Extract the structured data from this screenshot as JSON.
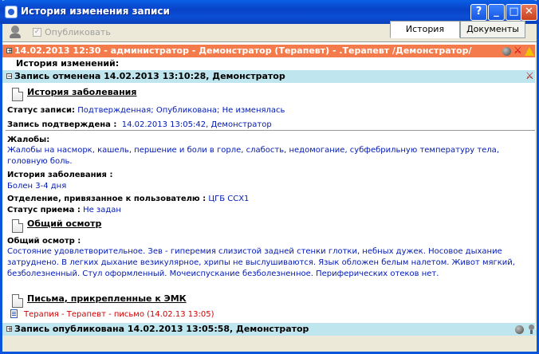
{
  "window": {
    "title": "История изменения записи"
  },
  "toolbar": {
    "publish_label": "Опубликовать",
    "publish_checked": true,
    "tabs": [
      "История",
      "Документы"
    ],
    "active_tab": "История"
  },
  "record": {
    "header": "14.02.2013 12:30 - администратор - Демонстратор (Терапевт) - .Терапевт /Демонстратор/",
    "history_label": "История изменений:",
    "cancelled_header": "Запись отменена  14.02.2013 13:10:28, Демонстратор",
    "sections": {
      "disease_history_title": "История заболевания",
      "status_label": "Статус записи:",
      "status_value": "Подтвержденная; Опубликована; Не изменялась",
      "confirmed_label": "Запись подтверждена :",
      "confirmed_value": "14.02.2013 13:05:42, Демонстратор",
      "complaints_label": "Жалобы:",
      "complaints_value": "Жалобы на насморк, кашель, першение и боли в горле, слабость, недомогание, субфебрильную температуру тела, головную боль.",
      "disease_label": "История заболевания :",
      "disease_value": "Болен 3-4 дня",
      "department_label": "Отделение, привязанное к пользователю :",
      "department_value": "ЦГБ ССХ1",
      "visit_status_label": "Статус приема :",
      "visit_status_value": "Не задан",
      "exam_title": "Общий осмотр",
      "exam_label": "Общий осмотр :",
      "exam_value": "Состояние удовлетворительное. Зев - гиперемия слизистой задней стенки глотки, небных дужек. Носовое дыхание затруднено. В легких дыхание везикулярное, хрипы не выслушиваются. Язык обложен белым налетом. Живот мягкий, безболезненный. Стул оформленный. Мочеиспускание безболезненное. Периферических отеков нет.",
      "letters_title": "Письма, прикрепленные к ЭМК",
      "letter_item": "Терапия - Терапевт - письмо (14.02.13 13:05)"
    },
    "published_header": "Запись опубликована  14.02.2013 13:05:58, Демонстратор"
  }
}
